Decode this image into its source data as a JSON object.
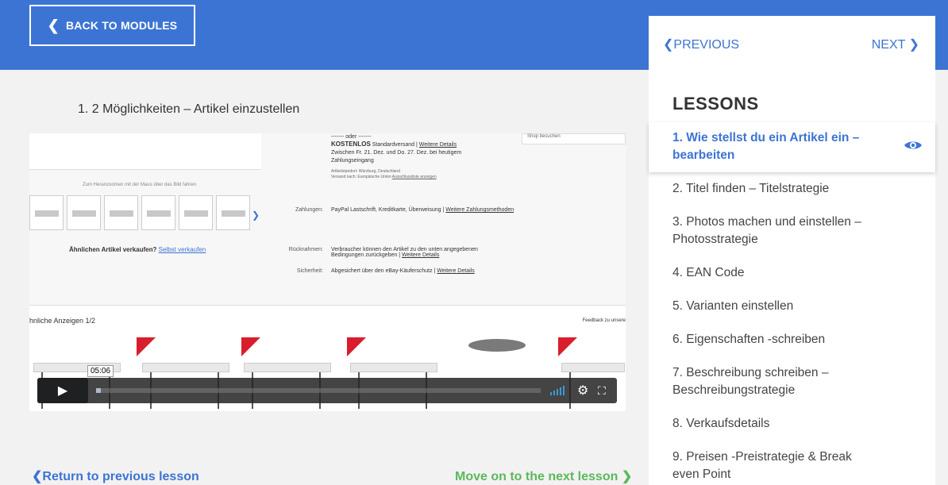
{
  "header": {
    "back_label": "BACK TO MODULES"
  },
  "main": {
    "title": "1.  2 Möglichkeiten – Artikel einzustellen"
  },
  "video": {
    "ship_block": {
      "line1": "------- oder -------",
      "kostenlos": "KOSTENLOS",
      "standard": "Standardversand |",
      "weitere": "Weitere Details",
      "line2": "Zwischen Fr. 21. Dez. und Do. 27. Dez. bei heutigem",
      "line3": "Zahlungseingang",
      "artikel": "Artikelstandort: Würzburg, Deutschland",
      "versand": "Versand nach: Europäische Union",
      "ausschluss": "Ausschlussliste anzeigen"
    },
    "shop_btn": "Shop besuchen",
    "zoom_hint": "Zum Heranzoomen mit der Maus über das Bild fahren",
    "similar_sell_text": "Ähnlichen Artikel verkaufen?",
    "similar_sell_link": "Selbst verkaufen",
    "payments_label": "Zahlungen:",
    "payments_text": "PayPal  Lastschrift, Kreditkarte, Überweisung  |",
    "payments_link": "Weitere Zahlungsmethoden",
    "returns_label": "Rücknahmen:",
    "returns_text1": "Verbraucher können den Artikel zu den unten angegebenen",
    "returns_text2": "Bedingungen zurückgeben |",
    "returns_link": "Weitere Details",
    "security_label": "Sicherheit:",
    "security_text": "Abgesichert über den eBay-Käuferschutz  |",
    "security_link": "Weitere Details",
    "similar_ads": "hnliche Anzeigen  1/2",
    "feedback": "Feedback zu unsere",
    "time": "05:06",
    "progress": 0.01
  },
  "footer": {
    "prev_label": "Return to previous lesson",
    "next_label": "Move on to the next lesson"
  },
  "sidebar": {
    "previous": "PREVIOUS",
    "next": "NEXT",
    "title": "LESSONS",
    "lessons": [
      {
        "label": "1. Wie stellst du ein Artikel ein – bearbeiten"
      },
      {
        "label": "2. Titel finden – Titelstrategie"
      },
      {
        "label": "3. Photos machen und einstellen – Photosstrategie"
      },
      {
        "label": "4. EAN Code"
      },
      {
        "label": "5. Varianten einstellen"
      },
      {
        "label": "6. Eigenschaften -schreiben"
      },
      {
        "label": "7. Beschreibung schreiben – Beschreibungstrategie"
      },
      {
        "label": "8. Verkaufsdetails"
      },
      {
        "label": "9. Preisen -Preistrategie & Break even Point"
      }
    ]
  },
  "colors": {
    "primary": "#3c74d4",
    "success": "#5cb85c",
    "badge_red": "#d81e2c"
  }
}
